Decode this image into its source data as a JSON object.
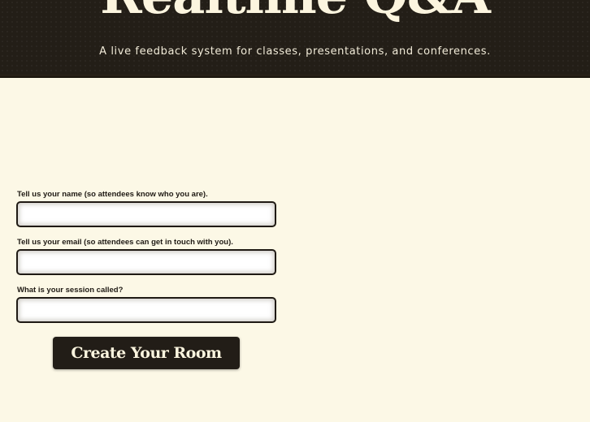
{
  "header": {
    "title": "Realtime Q&A",
    "tagline": "A live feedback system for classes, presentations, and conferences."
  },
  "form": {
    "name_label": "Tell us your name (so attendees know who you are).",
    "name_value": "",
    "email_label": "Tell us your email (so attendees can get in touch with you).",
    "email_value": "",
    "session_label": "What is your session called?",
    "session_value": "",
    "submit_label": "Create Your Room"
  },
  "colors": {
    "page_background": "#fcf8e6",
    "header_background": "#231e17",
    "button_background": "#221d17",
    "text_light": "#fcf5df",
    "text_dark": "#1f1a14"
  }
}
